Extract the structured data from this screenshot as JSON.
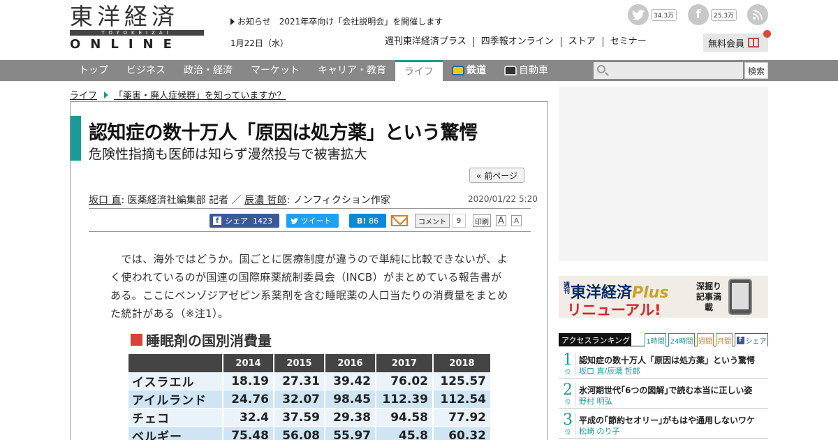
{
  "header": {
    "logo": {
      "kanji": "東洋経済",
      "romaji": "TOYOKEIZAI",
      "online": "ONLINE"
    },
    "notice": "お知らせ　2021年卒向け「会社説明会」を開催します",
    "date": "1月22日（水）",
    "social": {
      "twitter_count": "34.3万",
      "facebook_count": "25.3万"
    },
    "subnav": [
      "週刊東洋経済プラス",
      "四季報オンライン",
      "ストア",
      "セミナー"
    ],
    "member_button": "無料会員"
  },
  "nav": {
    "items": [
      "トップ",
      "ビジネス",
      "政治・経済",
      "マーケット",
      "キャリア・教育",
      "ライフ",
      "鉄道",
      "自動車"
    ],
    "active": "ライフ",
    "search_button": "検索"
  },
  "breadcrumb": {
    "section": "ライフ",
    "series": "「薬害・廃人症候群」を知っていますか？"
  },
  "article": {
    "title": "認知症の数十万人「原因は処方薬」という驚愕",
    "subtitle": "危険性指摘も医師は知らず漫然投与で被害拡大",
    "prev_page": "« 前ページ",
    "author1": "坂口 直",
    "author1_role": ": 医薬経済社編集部 記者 ／ ",
    "author2": "辰濃 哲郎",
    "author2_role": ": ノンフィクション作家",
    "published": "2020/01/22 5:20",
    "share": {
      "facebook_label": "シェア",
      "facebook_count": "1423",
      "twitter_label": "ツイート",
      "hatena_label": "B!",
      "hatena_count": "86",
      "comment_label": "コメント",
      "comment_count": "9",
      "print_label": "印刷",
      "font_large": "A",
      "font_small": "A"
    },
    "body": "　では、海外ではどうか。国ごとに医療制度が違うので単純に比較できないが、よく使われているのが国連の国際麻薬統制委員会（INCB）がまとめている報告書がある。ここにベンゾジアゼピン系薬剤を含む睡眠薬の人口当たりの消費量をまとめた統計がある（※注1）。"
  },
  "chart_data": {
    "type": "table",
    "title": "睡眠剤の国別消費量",
    "columns": [
      "2014",
      "2015",
      "2016",
      "2017",
      "2018"
    ],
    "rows": [
      {
        "label": "イスラエル",
        "values": [
          "18.19",
          "27.31",
          "39.42",
          "76.02",
          "125.57"
        ]
      },
      {
        "label": "アイルランド",
        "values": [
          "24.76",
          "32.07",
          "98.45",
          "112.39",
          "112.54"
        ]
      },
      {
        "label": "チェコ",
        "values": [
          "32.4",
          "37.59",
          "29.38",
          "94.58",
          "77.92"
        ]
      },
      {
        "label": "ベルギー",
        "values": [
          "75.48",
          "56.08",
          "55.97",
          "45.8",
          "60.32"
        ]
      }
    ]
  },
  "sidebar": {
    "banner": {
      "weekly": "週刊",
      "brand": "東洋経済",
      "plus": "Plus",
      "renewal": "リニューアル!",
      "tagline": "深掘り記事満載"
    },
    "ranking": {
      "title": "アクセスランキング",
      "tabs": [
        "1時間",
        "24時間",
        "週間",
        "月間",
        "シェア"
      ],
      "unit": "位",
      "items": [
        {
          "rank": "1",
          "headline": "認知症の数十万人「原因は処方薬」という驚愕",
          "author": "坂口 直/辰濃 哲郎"
        },
        {
          "rank": "2",
          "headline": "氷河期世代｢6つの図解｣で読む本当に正しい姿",
          "author": "野村 明弘"
        },
        {
          "rank": "3",
          "headline": "平成の｢節約セオリー｣がもはや通用しないワケ",
          "author": "松崎 のり子"
        }
      ]
    }
  },
  "colors": {
    "accent": "#1a9a97",
    "nav_bg": "#888888",
    "facebook": "#3b5998",
    "twitter": "#1da1f2",
    "hatena": "#0a8ad6",
    "marker_red": "#d9413a"
  }
}
